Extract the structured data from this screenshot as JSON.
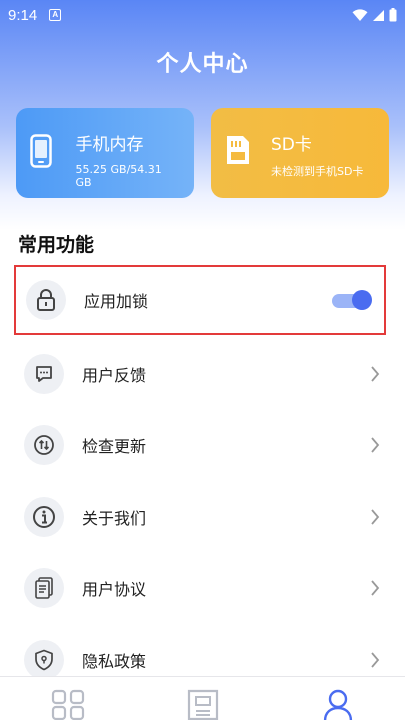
{
  "status_bar": {
    "time": "9:14",
    "notification_letter": "A"
  },
  "header": {
    "title": "个人中心"
  },
  "storage_cards": {
    "phone": {
      "title": "手机内存",
      "subtitle": "55.25 GB/54.31 GB"
    },
    "sd": {
      "title": "SD卡",
      "subtitle": "未检测到手机SD卡"
    }
  },
  "section": {
    "title": "常用功能"
  },
  "menu": [
    {
      "label": "应用加锁",
      "icon": "lock-icon",
      "control": "toggle",
      "toggle_on": true
    },
    {
      "label": "用户反馈",
      "icon": "feedback-icon",
      "control": "chevron"
    },
    {
      "label": "检查更新",
      "icon": "update-icon",
      "control": "chevron"
    },
    {
      "label": "关于我们",
      "icon": "info-icon",
      "control": "chevron"
    },
    {
      "label": "用户协议",
      "icon": "document-icon",
      "control": "chevron"
    },
    {
      "label": "隐私政策",
      "icon": "shield-icon",
      "control": "chevron"
    }
  ],
  "bottom_nav": [
    {
      "icon": "grid-icon",
      "active": false
    },
    {
      "icon": "sim-card-icon",
      "active": false
    },
    {
      "icon": "person-icon",
      "active": true
    }
  ],
  "colors": {
    "accent": "#4a6cf0",
    "highlight_border": "#e33a3a",
    "phone_card": "#5aa3f7",
    "sd_card": "#f5bb40"
  }
}
